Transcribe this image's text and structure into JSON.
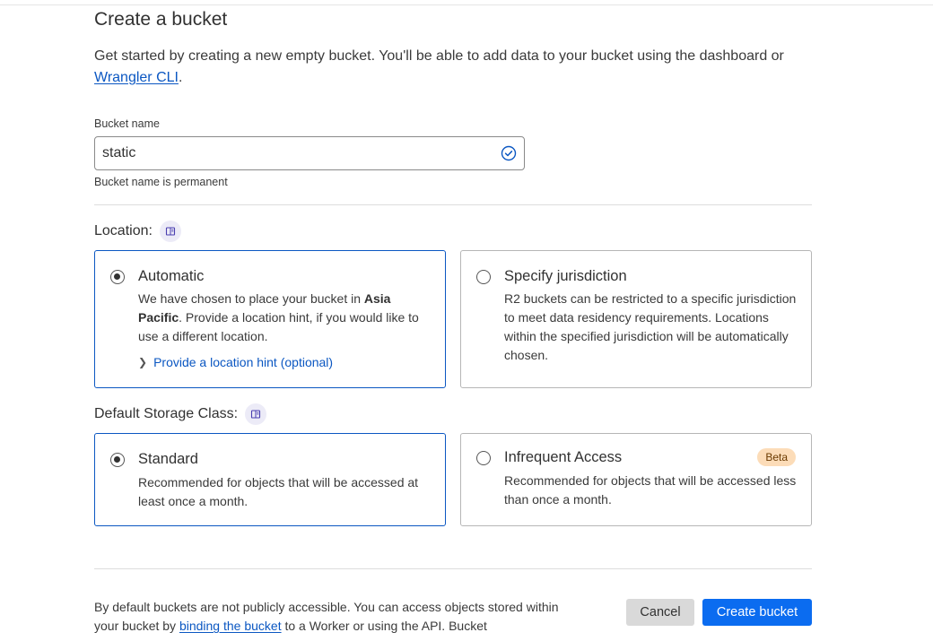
{
  "page": {
    "title": "Create a bucket",
    "intro_text": "Get started by creating a new empty bucket. You'll be able to add data to your bucket using the dashboard or ",
    "intro_link": "Wrangler CLI",
    "intro_end": "."
  },
  "bucket_name": {
    "label": "Bucket name",
    "value": "static",
    "hint": "Bucket name is permanent",
    "valid_icon": "check-circle-icon"
  },
  "location": {
    "label": "Location:",
    "info_icon": "book-icon",
    "options": [
      {
        "title": "Automatic",
        "selected": true,
        "desc_before": "We have chosen to place your bucket in ",
        "desc_bold": "Asia Pacific",
        "desc_after": ". Provide a location hint, if you would like to use a different location.",
        "link": "Provide a location hint (optional)"
      },
      {
        "title": "Specify jurisdiction",
        "selected": false,
        "desc": "R2 buckets can be restricted to a specific jurisdiction to meet data residency requirements. Locations within the specified jurisdiction will be automatically chosen."
      }
    ]
  },
  "storage_class": {
    "label": "Default Storage Class:",
    "info_icon": "book-icon",
    "options": [
      {
        "title": "Standard",
        "selected": true,
        "desc": "Recommended for objects that will be accessed at least once a month."
      },
      {
        "title": "Infrequent Access",
        "selected": false,
        "badge": "Beta",
        "desc": "Recommended for objects that will be accessed less than once a month."
      }
    ]
  },
  "footer": {
    "text_before": "By default buckets are not publicly accessible. You can access objects stored within your bucket by ",
    "link": "binding the bucket",
    "text_after": " to a Worker or using the API. Bucket"
  },
  "buttons": {
    "cancel": "Cancel",
    "create": "Create bucket"
  },
  "colors": {
    "accent": "#0b6cf0",
    "link": "#0b57c2",
    "beta_badge": "#fcdcb8"
  }
}
